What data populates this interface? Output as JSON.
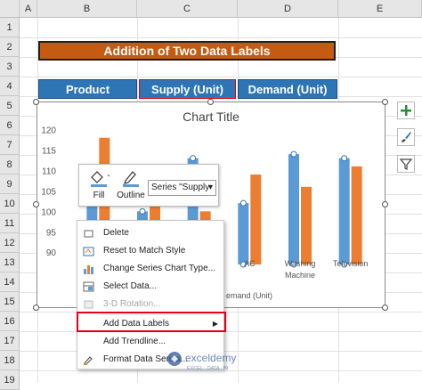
{
  "sheet": {
    "columns": [
      "A",
      "B",
      "C",
      "D",
      "E"
    ],
    "rows": [
      "1",
      "2",
      "3",
      "4",
      "5",
      "6",
      "7",
      "8",
      "9",
      "10",
      "11",
      "12",
      "13",
      "14",
      "15",
      "16",
      "17",
      "18",
      "19"
    ]
  },
  "banner": {
    "title": "Addition of Two Data Labels"
  },
  "table_headers": [
    "Product",
    "Supply (Unit)",
    "Demand (Unit)"
  ],
  "chart_data": {
    "type": "bar",
    "title": "Chart Title",
    "categories": [
      "",
      "",
      "",
      "AC",
      "Washing Machine",
      "Television"
    ],
    "visible_category_labels": [
      "AC",
      "Washing",
      "Machine",
      "Television"
    ],
    "series": [
      {
        "values": [
          102,
          100,
          113,
          102,
          114,
          113
        ],
        "color": "#5b9bd5"
      },
      {
        "values": [
          118,
          104,
          100,
          109,
          106,
          111
        ],
        "color": "#ed7d31"
      }
    ],
    "y_ticks": [
      90,
      95,
      100,
      105,
      110,
      115,
      120
    ],
    "ylim": [
      87,
      121
    ],
    "xlabel_visible": "emand (Unit)"
  },
  "mini_toolbar": {
    "fill_label": "Fill",
    "outline_label": "Outline",
    "series_select": "Series \"Supply"
  },
  "context_menu": {
    "items": [
      {
        "label": "Delete",
        "disabled": false,
        "icon": "delete-icon"
      },
      {
        "label": "Reset to Match Style",
        "disabled": false,
        "icon": "reset-style-icon"
      },
      {
        "label": "Change Series Chart Type...",
        "disabled": false,
        "icon": "chart-type-icon"
      },
      {
        "label": "Select Data...",
        "disabled": false,
        "icon": "select-data-icon"
      },
      {
        "label": "3-D Rotation...",
        "disabled": true,
        "icon": "rotation-icon"
      },
      {
        "label": "Add Data Labels",
        "disabled": false,
        "icon": "",
        "submenu": true
      },
      {
        "label": "Add Trendline...",
        "disabled": false,
        "icon": ""
      },
      {
        "label": "Format Data Series...",
        "disabled": false,
        "icon": "format-series-icon"
      }
    ]
  },
  "watermark": {
    "name": "exceldemy",
    "tagline": "EXCEL · DATA · BI"
  },
  "colors": {
    "accent_red": "#e0001b",
    "banner": "#c55a11",
    "header_blue": "#2e75b6"
  }
}
